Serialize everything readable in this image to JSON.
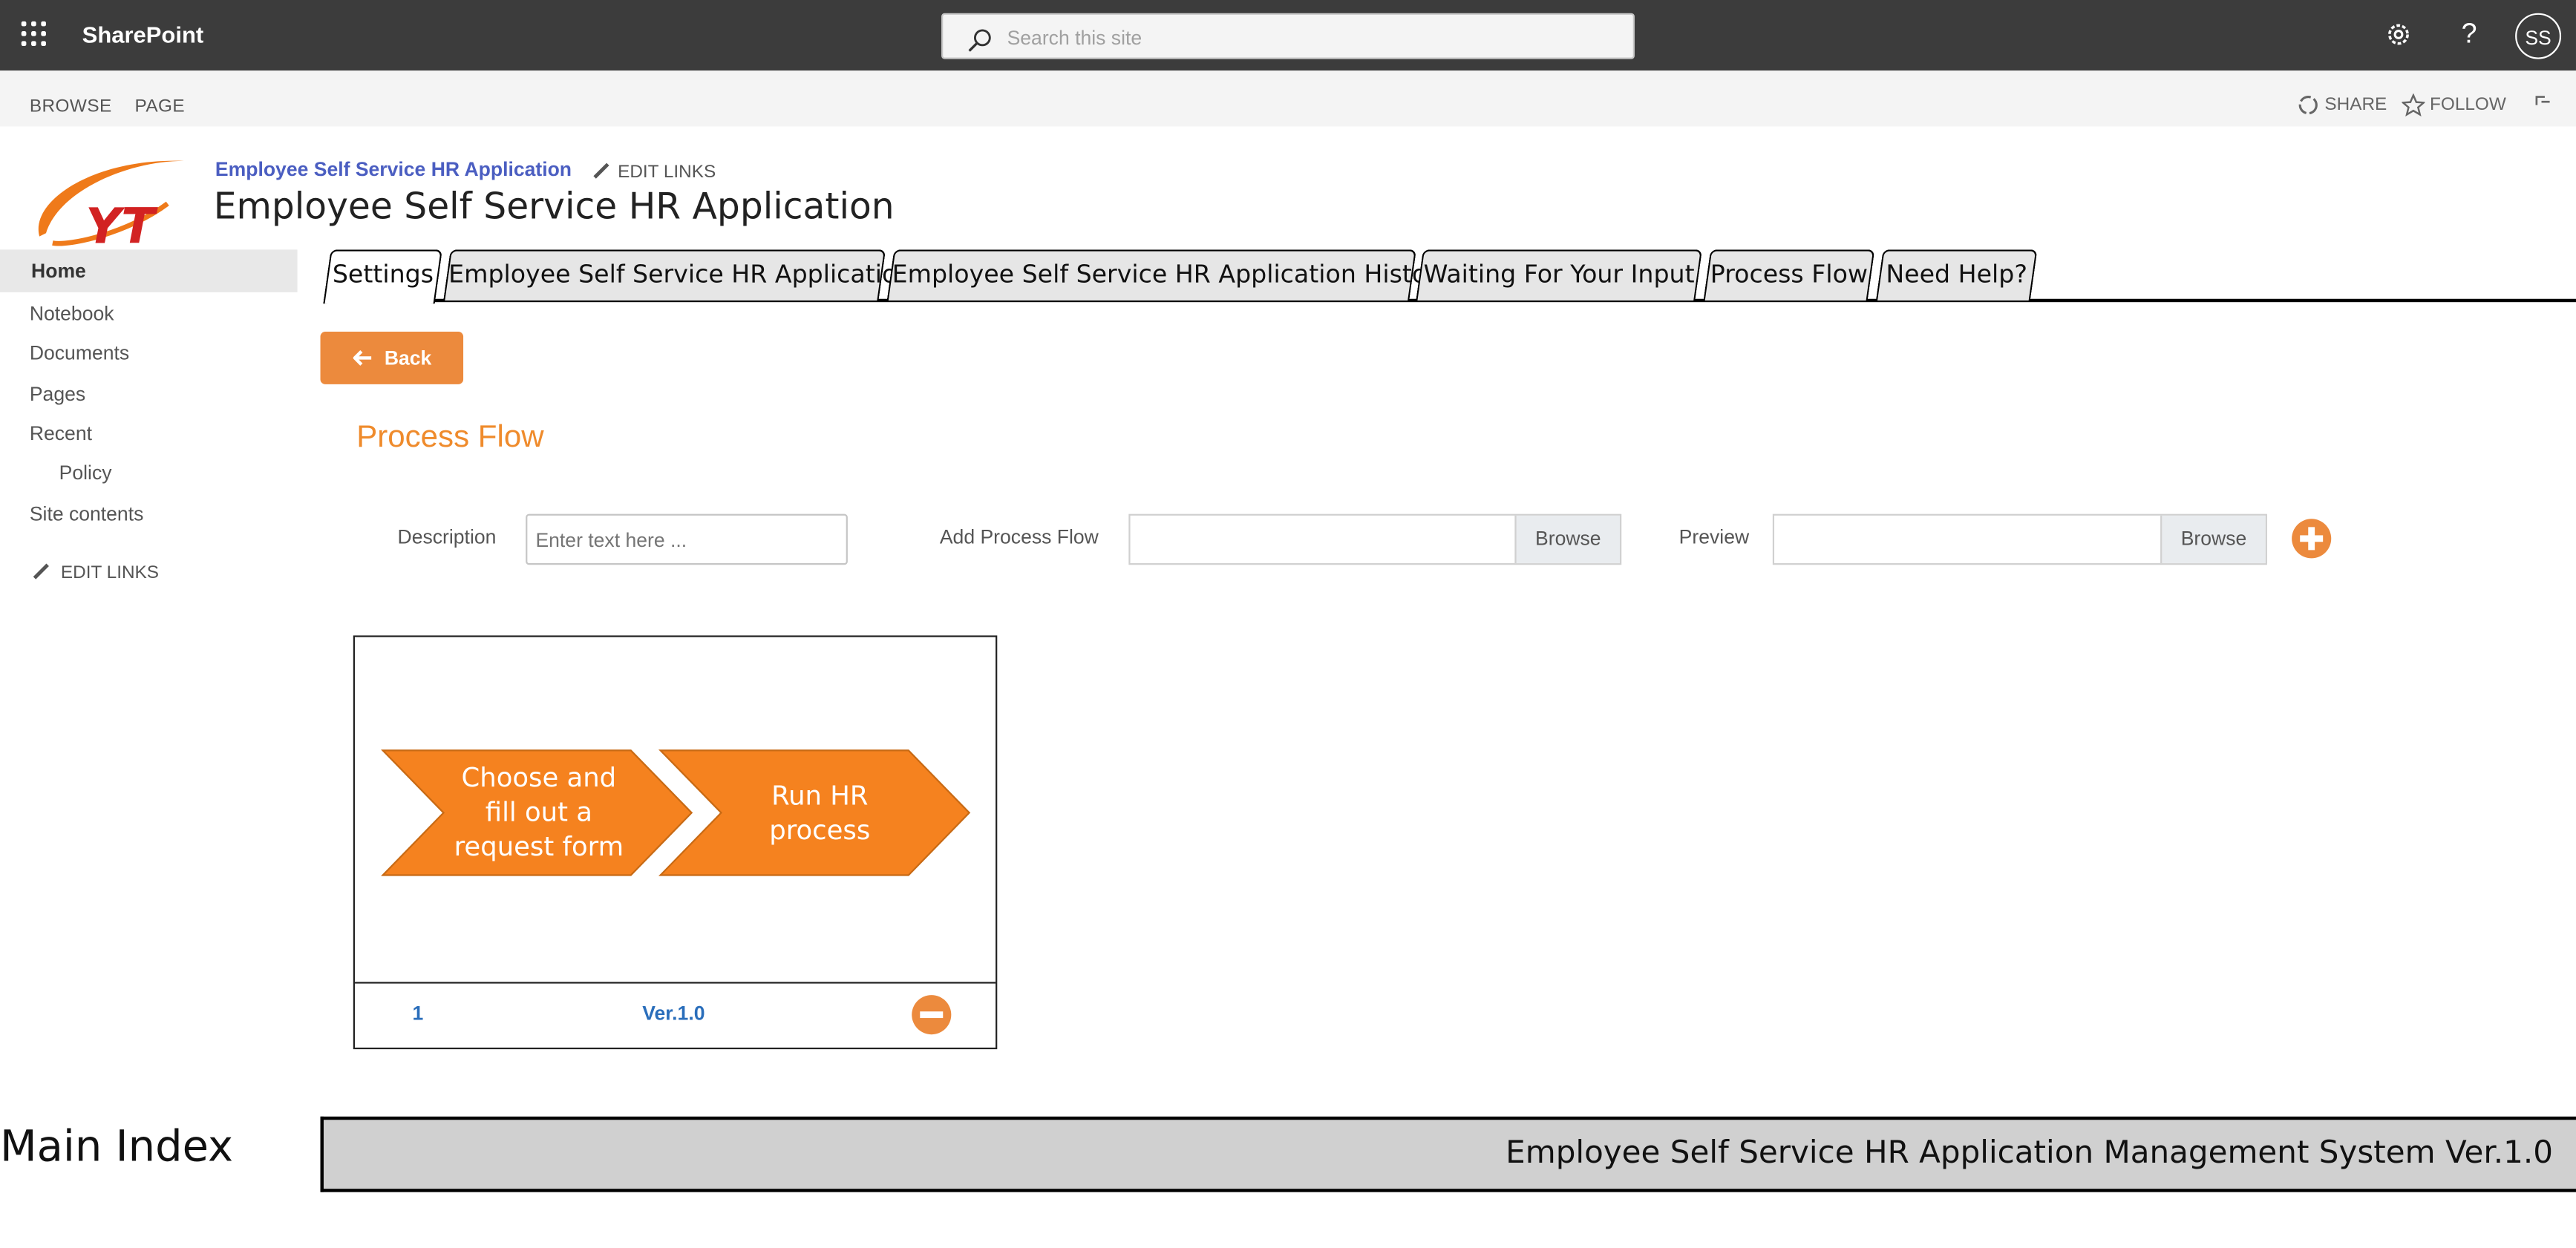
{
  "suite": {
    "brand": "SharePoint",
    "search_placeholder": "Search this site",
    "avatar_initials": "SS"
  },
  "ribbon": {
    "tabs": [
      "BROWSE",
      "PAGE"
    ],
    "share": "SHARE",
    "follow": "FOLLOW"
  },
  "header": {
    "site_link": "Employee Self Service HR Application",
    "edit_links": "EDIT LINKS",
    "title": "Employee Self Service HR Application"
  },
  "nav": {
    "home": "Home",
    "items": [
      "Notebook",
      "Documents",
      "Pages",
      "Recent",
      "Policy",
      "Site contents"
    ],
    "edit_links": "EDIT LINKS"
  },
  "tabs": [
    "Settings",
    "Employee Self Service HR Application",
    "Employee Self Service HR Application History",
    "Waiting For Your Input",
    "Process Flow",
    "Need Help?"
  ],
  "back_label": "Back",
  "process_flow": {
    "title": "Process Flow",
    "description_label": "Description",
    "description_placeholder": "Enter text here ...",
    "add_label": "Add Process Flow",
    "preview_label": "Preview",
    "browse_label": "Browse"
  },
  "card": {
    "steps": [
      "Choose and fill out a request form",
      "Run HR process"
    ],
    "number": "1",
    "version": "Ver.1.0"
  },
  "footer": {
    "left": "Main Index",
    "right": "Employee Self Service HR Application Management System Ver.1.0"
  },
  "colors": {
    "accent": "#ec8a3d",
    "title_orange": "#ef8b2c",
    "link_blue": "#4b5ec1",
    "suite_bar": "#3c3c3c"
  }
}
